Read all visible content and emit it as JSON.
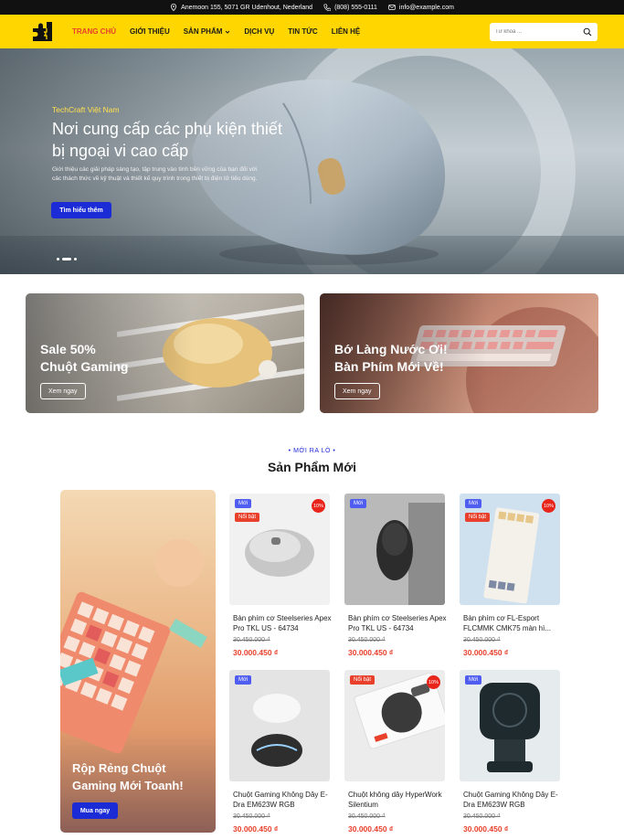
{
  "topbar": {
    "address": "Anemoon 155, 5071 GR Udenhout, Nederland",
    "phone": "(808) 555-0111",
    "email": "info@example.com"
  },
  "nav": {
    "items": [
      {
        "label": "TRANG CHỦ"
      },
      {
        "label": "GIỚI THIỆU"
      },
      {
        "label": "SẢN PHẨM"
      },
      {
        "label": "DỊCH VỤ"
      },
      {
        "label": "TIN TỨC"
      },
      {
        "label": "LIÊN HỆ"
      }
    ],
    "search_placeholder": "Từ khoá ..."
  },
  "hero": {
    "subtitle": "TechCraft Việt Nam",
    "title": "Nơi cung cấp các phụ kiện thiết bị ngoại vi cao cấp",
    "description": "Giới thiệu các giải pháp sáng tạo, tập trung vào tính bền vững của bạn đối với các thách thức về kỹ thuật và thiết kế quy trình trong thiết bị điện tử tiêu dùng.",
    "button": "Tìm hiểu thêm"
  },
  "banners": [
    {
      "title_line1": "Sale 50%",
      "title_line2": "Chuột Gaming",
      "button": "Xem ngay"
    },
    {
      "title_line1": "Bớ Làng Nước Ơi!",
      "title_line2": "Bàn Phím Mới Về!",
      "button": "Xem ngay"
    }
  ],
  "section": {
    "tag": "MỚI RA LÒ",
    "title": "Sản Phẩm Mới"
  },
  "promo": {
    "title": "Rộp Rẻng Chuột Gaming Mới Toanh!",
    "button": "Mua ngay"
  },
  "products": [
    {
      "name": "Bàn phím cơ Steelseries Apex Pro TKL US - 64734",
      "old_price": "30.450.000 ₫",
      "price": "30.000.450 ₫",
      "badge_new": "Mới",
      "badge_hot": "Nổi bật",
      "discount": "10%"
    },
    {
      "name": "Bàn phím cơ Steelseries Apex Pro TKL US - 64734",
      "old_price": "30.450.000 ₫",
      "price": "30.000.450 ₫",
      "badge_new": "Mới",
      "badge_hot": "",
      "discount": ""
    },
    {
      "name": "Bàn phím cơ FL-Esport FLCMMK CMK75 màn hì...",
      "old_price": "30.450.000 ₫",
      "price": "30.000.450 ₫",
      "badge_new": "Mới",
      "badge_hot": "Nổi bật",
      "discount": "10%"
    },
    {
      "name": "Chuột Gaming Không Dây E-Dra EM623W RGB",
      "old_price": "30.450.000 ₫",
      "price": "30.000.450 ₫",
      "badge_new": "Mới",
      "badge_hot": "",
      "discount": ""
    },
    {
      "name": "Chuột không dây HyperWork Silentium",
      "old_price": "30.450.000 ₫",
      "price": "30.000.450 ₫",
      "badge_new": "",
      "badge_hot": "Nổi bật",
      "discount": "10%"
    },
    {
      "name": "Chuột Gaming Không Dây E-Dra EM623W RGB",
      "old_price": "30.450.000 ₫",
      "price": "30.000.450 ₫",
      "badge_new": "Mới",
      "badge_hot": "",
      "discount": ""
    }
  ],
  "colors": {
    "brand_yellow": "#ffd600",
    "accent_blue": "#1b2bd6",
    "sale_red": "#e8402b"
  }
}
